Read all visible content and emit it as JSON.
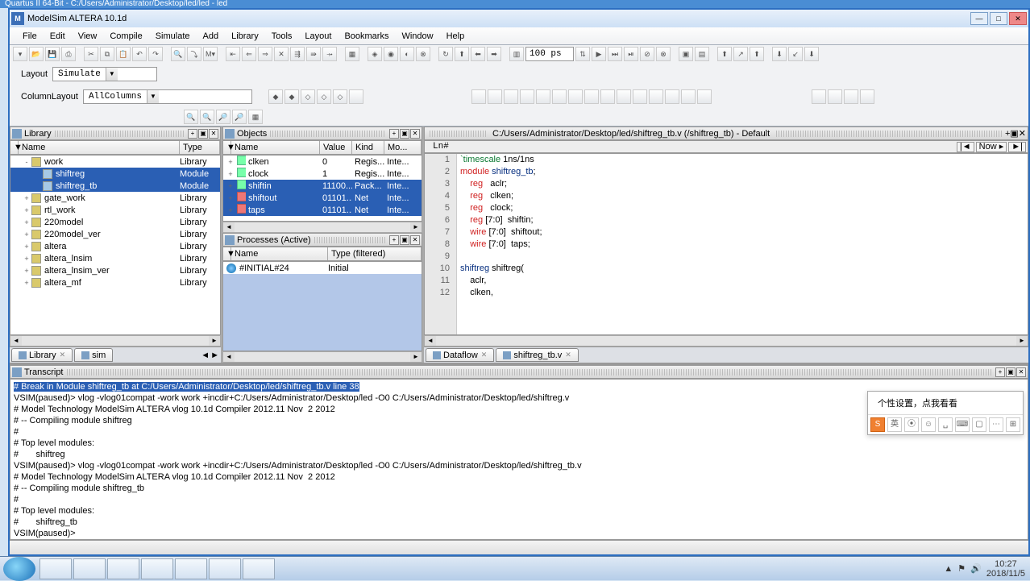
{
  "bgTitle": "Quartus II 64-Bit - C:/Users/Administrator/Desktop/led/led - led",
  "title": "ModelSim ALTERA 10.1d",
  "menu": [
    "File",
    "Edit",
    "View",
    "Compile",
    "Simulate",
    "Add",
    "Library",
    "Tools",
    "Layout",
    "Bookmarks",
    "Window",
    "Help"
  ],
  "layout": {
    "label": "Layout",
    "value": "Simulate"
  },
  "columnLayout": {
    "label": "ColumnLayout",
    "value": "AllColumns"
  },
  "runTime": "100 ps",
  "library": {
    "title": "Library",
    "cols": [
      "Name",
      "Type"
    ],
    "rows": [
      {
        "ind": 1,
        "exp": "-",
        "icon": "lib",
        "name": "work",
        "type": "Library",
        "sel": false
      },
      {
        "ind": 2,
        "exp": "",
        "icon": "mod",
        "name": "shiftreg",
        "type": "Module",
        "sel": true
      },
      {
        "ind": 2,
        "exp": "",
        "icon": "mod",
        "name": "shiftreg_tb",
        "type": "Module",
        "sel": true
      },
      {
        "ind": 1,
        "exp": "+",
        "icon": "lib",
        "name": "gate_work",
        "type": "Library",
        "sel": false
      },
      {
        "ind": 1,
        "exp": "+",
        "icon": "lib",
        "name": "rtl_work",
        "type": "Library",
        "sel": false
      },
      {
        "ind": 1,
        "exp": "+",
        "icon": "lib",
        "name": "220model",
        "type": "Library",
        "sel": false
      },
      {
        "ind": 1,
        "exp": "+",
        "icon": "lib",
        "name": "220model_ver",
        "type": "Library",
        "sel": false
      },
      {
        "ind": 1,
        "exp": "+",
        "icon": "lib",
        "name": "altera",
        "type": "Library",
        "sel": false
      },
      {
        "ind": 1,
        "exp": "+",
        "icon": "lib",
        "name": "altera_lnsim",
        "type": "Library",
        "sel": false
      },
      {
        "ind": 1,
        "exp": "+",
        "icon": "lib",
        "name": "altera_lnsim_ver",
        "type": "Library",
        "sel": false
      },
      {
        "ind": 1,
        "exp": "+",
        "icon": "lib",
        "name": "altera_mf",
        "type": "Library",
        "sel": false
      }
    ],
    "tabs": [
      "Library",
      "sim"
    ]
  },
  "objects": {
    "title": "Objects",
    "cols": [
      "Name",
      "Value",
      "Kind",
      "Mo..."
    ],
    "rows": [
      {
        "icon": "sig",
        "name": "clken",
        "value": "0",
        "kind": "Regis...",
        "mode": "Inte...",
        "sel": false
      },
      {
        "icon": "sig",
        "name": "clock",
        "value": "1",
        "kind": "Regis...",
        "mode": "Inte...",
        "sel": false
      },
      {
        "icon": "sig",
        "name": "shiftin",
        "value": "11100...",
        "kind": "Pack...",
        "mode": "Inte...",
        "sel": true
      },
      {
        "icon": "net",
        "name": "shiftout",
        "value": "01101...",
        "kind": "Net",
        "mode": "Inte...",
        "sel": true
      },
      {
        "icon": "net",
        "name": "taps",
        "value": "01101...",
        "kind": "Net",
        "mode": "Inte...",
        "sel": true
      }
    ]
  },
  "processes": {
    "title": "Processes (Active)",
    "cols": [
      "Name",
      "Type (filtered)"
    ],
    "rows": [
      {
        "name": "#INITIAL#24",
        "type": "Initial"
      }
    ]
  },
  "editor": {
    "path": "C:/Users/Administrator/Desktop/led/shiftreg_tb.v (/shiftreg_tb) - Default",
    "lnLabel": "Ln#",
    "nowLabel": "Now",
    "lines": [
      {
        "n": 1,
        "seg": [
          [
            "green",
            "`timescale"
          ],
          [
            "",
            " 1ns/1ns"
          ]
        ]
      },
      {
        "n": 2,
        "seg": [
          [
            "red",
            "module"
          ],
          [
            "",
            " "
          ],
          [
            "navy",
            "shiftreg_tb"
          ],
          [
            "",
            ";"
          ]
        ]
      },
      {
        "n": 3,
        "seg": [
          [
            "",
            "    "
          ],
          [
            "red",
            "reg"
          ],
          [
            "",
            "   aclr;"
          ]
        ]
      },
      {
        "n": 4,
        "seg": [
          [
            "",
            "    "
          ],
          [
            "red",
            "reg"
          ],
          [
            "",
            "   clken;"
          ]
        ]
      },
      {
        "n": 5,
        "seg": [
          [
            "",
            "    "
          ],
          [
            "red",
            "reg"
          ],
          [
            "",
            "   clock;"
          ]
        ]
      },
      {
        "n": 6,
        "seg": [
          [
            "",
            "    "
          ],
          [
            "red",
            "reg"
          ],
          [
            "",
            " [7:0]  shiftin;"
          ]
        ]
      },
      {
        "n": 7,
        "seg": [
          [
            "",
            "    "
          ],
          [
            "red",
            "wire"
          ],
          [
            "",
            " [7:0]  shiftout;"
          ]
        ]
      },
      {
        "n": 8,
        "seg": [
          [
            "",
            "    "
          ],
          [
            "red",
            "wire"
          ],
          [
            "",
            " [7:0]  taps;"
          ]
        ]
      },
      {
        "n": 9,
        "seg": [
          [
            "",
            ""
          ]
        ]
      },
      {
        "n": 10,
        "seg": [
          [
            "navy",
            "shiftreg"
          ],
          [
            "",
            " shiftreg("
          ]
        ]
      },
      {
        "n": 11,
        "seg": [
          [
            "",
            "    aclr,"
          ]
        ]
      },
      {
        "n": 12,
        "seg": [
          [
            "",
            "    clken,"
          ]
        ]
      }
    ],
    "tabs": [
      {
        "label": "Dataflow",
        "icon": true
      },
      {
        "label": "shiftreg_tb.v",
        "icon": true
      }
    ]
  },
  "transcript": {
    "title": "Transcript",
    "lines": [
      "§# Break in Module shiftreg_tb at C:/Users/Administrator/Desktop/led/shiftreg_tb.v line 38",
      "VSIM(paused)> vlog -vlog01compat -work work +incdir+C:/Users/Administrator/Desktop/led -O0 C:/Users/Administrator/Desktop/led/shiftreg.v",
      "# Model Technology ModelSim ALTERA vlog 10.1d Compiler 2012.11 Nov  2 2012",
      "# -- Compiling module shiftreg",
      "#",
      "# Top level modules:",
      "#       shiftreg",
      "VSIM(paused)> vlog -vlog01compat -work work +incdir+C:/Users/Administrator/Desktop/led -O0 C:/Users/Administrator/Desktop/led/shiftreg_tb.v",
      "# Model Technology ModelSim ALTERA vlog 10.1d Compiler 2012.11 Nov  2 2012",
      "# -- Compiling module shiftreg_tb",
      "#",
      "# Top level modules:",
      "#       shiftreg_tb",
      "",
      "VSIM(paused)> "
    ]
  },
  "ime": {
    "tip": "个性设置，点我看看",
    "btns": [
      "S",
      "英",
      "⦿",
      "☺",
      "␣",
      "⌨",
      "▢",
      "⋯",
      "⊞"
    ]
  },
  "tray": {
    "time": "10:27",
    "date": "2018/11/5"
  }
}
